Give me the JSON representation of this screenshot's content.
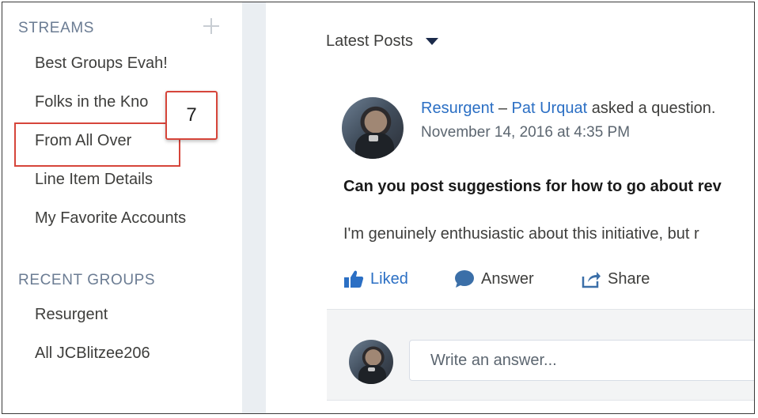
{
  "sidebar": {
    "streams_heading": "STREAMS",
    "add_stream_icon": "plus-icon",
    "streams": [
      {
        "label": "Best Groups Evah!"
      },
      {
        "label": "Folks in the Kno"
      },
      {
        "label": "From All Over"
      },
      {
        "label": "Line Item Details"
      },
      {
        "label": "My Favorite Accounts"
      }
    ],
    "recent_groups_heading": "RECENT GROUPS",
    "recent_groups": [
      {
        "label": "Resurgent"
      },
      {
        "label": "All JCBlitzee206"
      }
    ]
  },
  "callout": {
    "number": "7",
    "highlight_color": "#d6453a"
  },
  "feed": {
    "title": "Latest Posts",
    "dropdown_icon": "caret-down-icon",
    "post": {
      "group": "Resurgent",
      "separator": " – ",
      "author": "Pat Urquat",
      "action_text": " asked a question.",
      "date": "November 14, 2016 at 4:35 PM",
      "question": "Can you post suggestions for how to go about rev",
      "body": "I'm genuinely enthusiastic about this initiative, but r",
      "actions": {
        "liked": {
          "label": "Liked",
          "icon": "thumbs-up-icon"
        },
        "answer": {
          "label": "Answer",
          "icon": "speech-bubble-icon"
        },
        "share": {
          "label": "Share",
          "icon": "share-icon"
        }
      },
      "answer_placeholder": "Write an answer..."
    }
  },
  "colors": {
    "link": "#2b6fc4",
    "section_heading": "#6b7c93",
    "gutter": "#eaeef2"
  }
}
